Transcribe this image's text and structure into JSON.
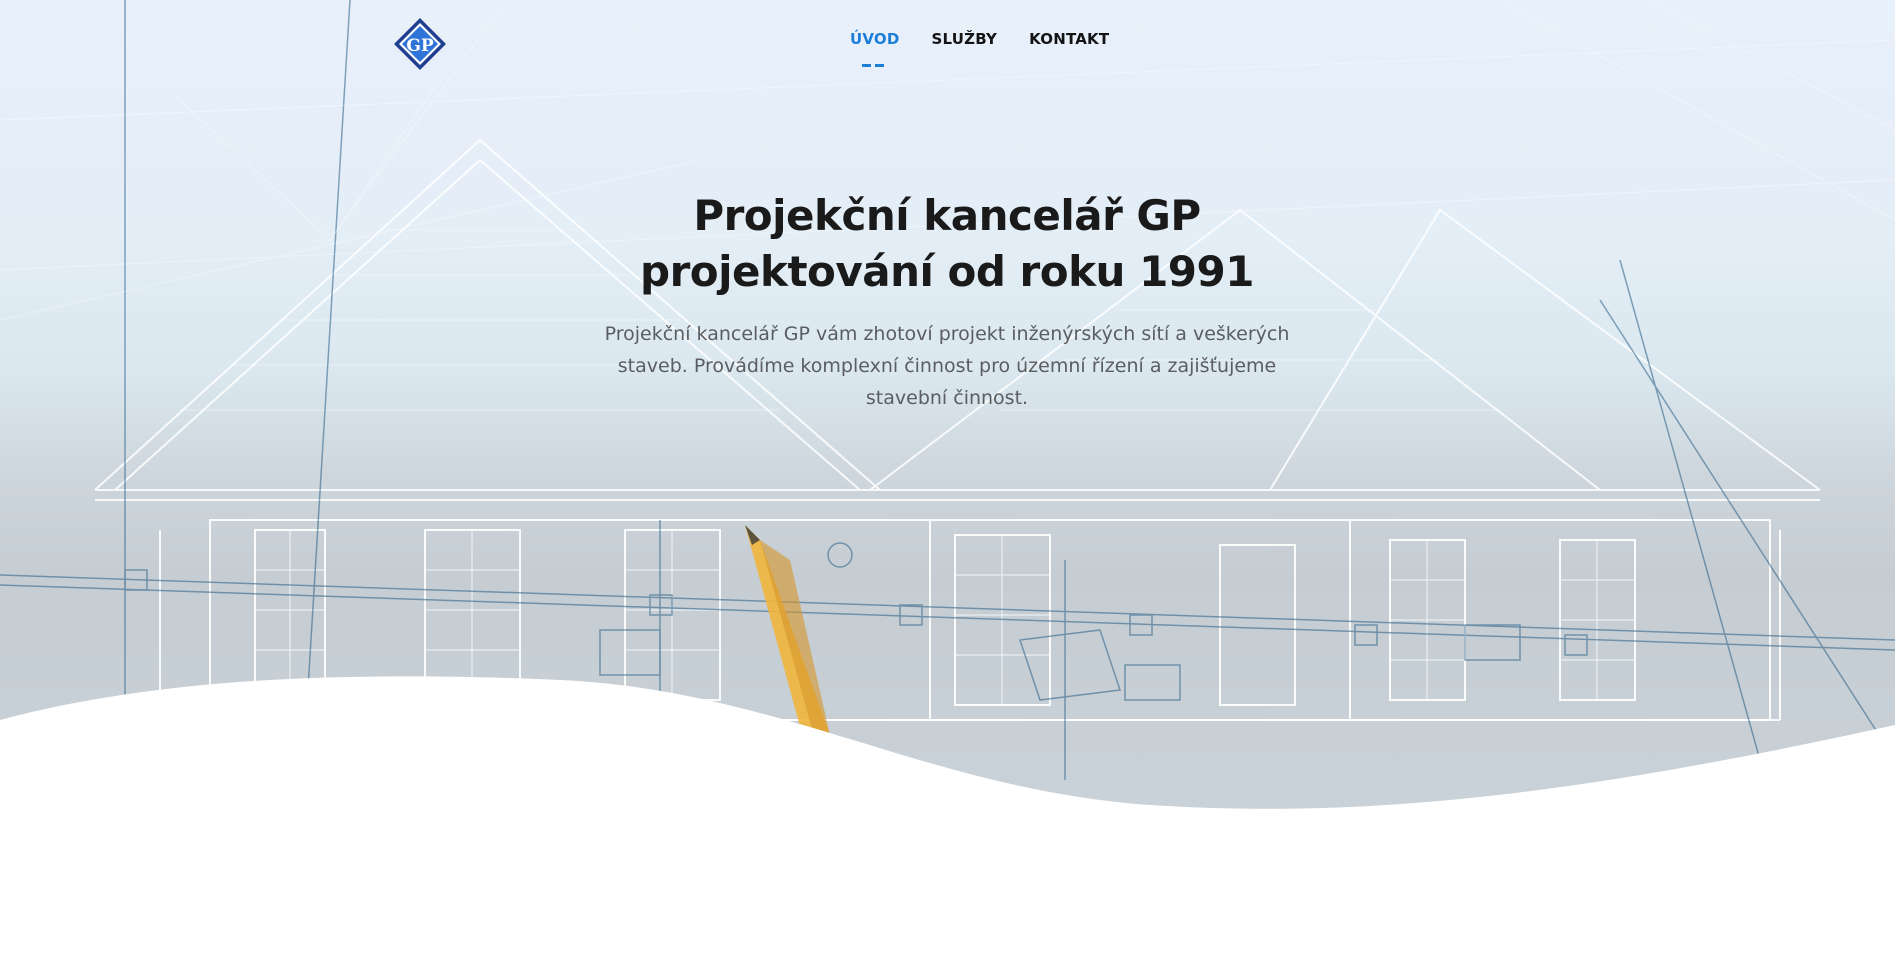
{
  "header": {
    "logo_text": "GP",
    "nav": [
      {
        "label": "ÚVOD",
        "active": true
      },
      {
        "label": "SLUŽBY",
        "active": false
      },
      {
        "label": "KONTAKT",
        "active": false
      }
    ]
  },
  "hero": {
    "title_line1": "Projekční kancelář GP",
    "title_line2": "projektování od roku 1991",
    "description": "Projekční kancelář GP vám zhotoví projekt inženýrských sítí a veškerých staveb. Provádíme komplexní činnost pro územní řízení a zajišťujeme stavební činnost."
  },
  "colors": {
    "accent": "#1c7ed6",
    "title": "#1a1a1a",
    "text": "#5a5d61",
    "blueprint_line": "#ffffff",
    "blueprint_dark": "#2a5f86"
  }
}
